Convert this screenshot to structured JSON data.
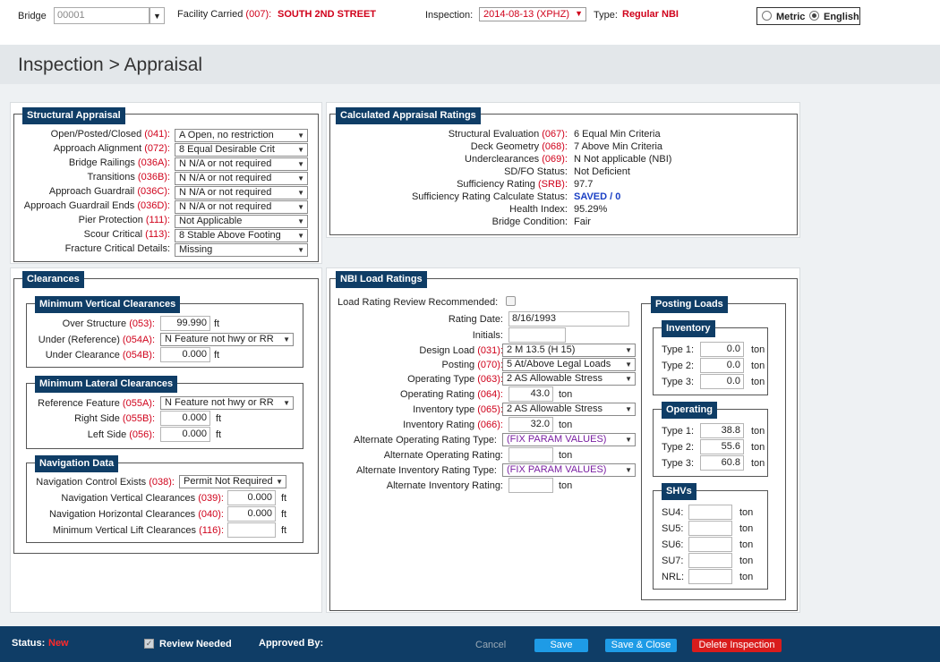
{
  "header": {
    "bridge_label": "Bridge",
    "bridge_value": "00001",
    "facility_label": "Facility Carried",
    "facility_code": "(007):",
    "facility_value": "SOUTH 2ND STREET",
    "inspection_label": "Inspection:",
    "inspection_value": "2014-08-13 (XPHZ)",
    "type_label": "Type:",
    "type_value": "Regular NBI",
    "metric_label": "Metric",
    "english_label": "English"
  },
  "page_title": "Inspection > Appraisal",
  "structural": {
    "title": "Structural Appraisal",
    "rows": [
      {
        "label": "Open/Posted/Closed",
        "code": "(041):",
        "value": "A Open, no restriction"
      },
      {
        "label": "Approach Alignment",
        "code": "(072):",
        "value": "8 Equal Desirable Crit"
      },
      {
        "label": "Bridge Railings",
        "code": "(036A):",
        "value": "N N/A or not required"
      },
      {
        "label": "Transitions",
        "code": "(036B):",
        "value": "N N/A or not required"
      },
      {
        "label": "Approach Guardrail",
        "code": "(036C):",
        "value": "N N/A or not required"
      },
      {
        "label": "Approach Guardrail Ends",
        "code": "(036D):",
        "value": "N N/A or not required"
      },
      {
        "label": "Pier Protection",
        "code": "(111):",
        "value": "Not Applicable"
      },
      {
        "label": "Scour Critical",
        "code": "(113):",
        "value": "8 Stable Above Footing"
      },
      {
        "label": "Fracture Critical Details:",
        "code": "",
        "value": "Missing"
      }
    ]
  },
  "calculated": {
    "title": "Calculated Appraisal Ratings",
    "rows": [
      {
        "label": "Structural Evaluation",
        "code": "(067):",
        "value": "6 Equal Min Criteria"
      },
      {
        "label": "Deck Geometry",
        "code": "(068):",
        "value": "7 Above Min Criteria"
      },
      {
        "label": "Underclearances",
        "code": "(069):",
        "value": "N Not applicable (NBI)"
      },
      {
        "label": "SD/FO Status:",
        "code": "",
        "value": "Not Deficient"
      },
      {
        "label": "Sufficiency Rating",
        "code": "(SRB):",
        "value": "97.7"
      },
      {
        "label": "Sufficiency Rating Calculate Status:",
        "code": "",
        "value": "SAVED / 0"
      },
      {
        "label": "Health Index:",
        "code": "",
        "value": "95.29%"
      },
      {
        "label": "Bridge Condition:",
        "code": "",
        "value": "Fair"
      }
    ]
  },
  "clearances": {
    "title": "Clearances",
    "vertical": {
      "title": "Minimum Vertical Clearances",
      "over_label": "Over Structure",
      "over_code": "(053):",
      "over_value": "99.990",
      "under_ref_label": "Under (Reference)",
      "under_ref_code": "(054A):",
      "under_ref_value": "N Feature not hwy or RR",
      "under_label": "Under Clearance",
      "under_code": "(054B):",
      "under_value": "0.000",
      "unit": "ft"
    },
    "lateral": {
      "title": "Minimum Lateral Clearances",
      "ref_label": "Reference Feature",
      "ref_code": "(055A):",
      "ref_value": "N Feature not hwy or RR",
      "right_label": "Right Side",
      "right_code": "(055B):",
      "right_value": "0.000",
      "left_label": "Left Side",
      "left_code": "(056):",
      "left_value": "0.000",
      "unit": "ft"
    },
    "navigation": {
      "title": "Navigation Data",
      "control_label": "Navigation Control Exists",
      "control_code": "(038):",
      "control_value": "Permit Not Required",
      "vert_label": "Navigation Vertical Clearances",
      "vert_code": "(039):",
      "vert_value": "0.000",
      "horiz_label": "Navigation Horizontal Clearances",
      "horiz_code": "(040):",
      "horiz_value": "0.000",
      "lift_label": "Minimum Vertical Lift Clearances",
      "lift_code": "(116):",
      "lift_value": "",
      "unit": "ft"
    }
  },
  "nbi": {
    "title": "NBI Load Ratings",
    "review_label": "Load Rating Review Recommended:",
    "rating_date_label": "Rating Date:",
    "rating_date_value": "8/16/1993",
    "initials_label": "Initials:",
    "initials_value": "",
    "design_label": "Design Load",
    "design_code": "(031):",
    "design_value": "2 M 13.5 (H 15)",
    "posting_label": "Posting",
    "posting_code": "(070):",
    "posting_value": "5 At/Above Legal Loads",
    "optype_label": "Operating Type",
    "optype_code": "(063):",
    "optype_value": "2 AS Allowable Stress",
    "oprating_label": "Operating Rating",
    "oprating_code": "(064):",
    "oprating_value": "43.0",
    "invtype_label": "Inventory type",
    "invtype_code": "(065):",
    "invtype_value": "2 AS Allowable Stress",
    "invrating_label": "Inventory Rating",
    "invrating_code": "(066):",
    "invrating_value": "32.0",
    "altoptype_label": "Alternate Operating Rating Type:",
    "altoptype_value": "(FIX PARAM VALUES)",
    "altop_label": "Alternate Operating Rating:",
    "altop_value": "",
    "altinvtype_label": "Alternate Inventory Rating Type:",
    "altinvtype_value": "(FIX PARAM VALUES)",
    "altinv_label": "Alternate Inventory Rating:",
    "altinv_value": "",
    "unit": "ton"
  },
  "posting": {
    "title": "Posting Loads",
    "inventory": {
      "title": "Inventory",
      "rows": [
        {
          "label": "Type 1:",
          "value": "0.0"
        },
        {
          "label": "Type 2:",
          "value": "0.0"
        },
        {
          "label": "Type 3:",
          "value": "0.0"
        }
      ]
    },
    "operating": {
      "title": "Operating",
      "rows": [
        {
          "label": "Type 1:",
          "value": "38.8"
        },
        {
          "label": "Type 2:",
          "value": "55.6"
        },
        {
          "label": "Type 3:",
          "value": "60.8"
        }
      ]
    },
    "shvs": {
      "title": "SHVs",
      "rows": [
        {
          "label": "SU4:",
          "value": ""
        },
        {
          "label": "SU5:",
          "value": ""
        },
        {
          "label": "SU6:",
          "value": ""
        },
        {
          "label": "SU7:",
          "value": ""
        },
        {
          "label": "NRL:",
          "value": ""
        }
      ]
    },
    "unit": "ton"
  },
  "footer": {
    "status_label": "Status:",
    "status_value": "New",
    "review_needed_label": "Review Needed",
    "approved_by_label": "Approved By:",
    "cancel": "Cancel",
    "save": "Save",
    "save_close": "Save & Close",
    "delete": "Delete Inspection"
  },
  "colors": {
    "navy": "#0f3d66",
    "red": "#d0021b",
    "blue_button": "#1e9be6",
    "delete_button": "#d91c1c"
  }
}
